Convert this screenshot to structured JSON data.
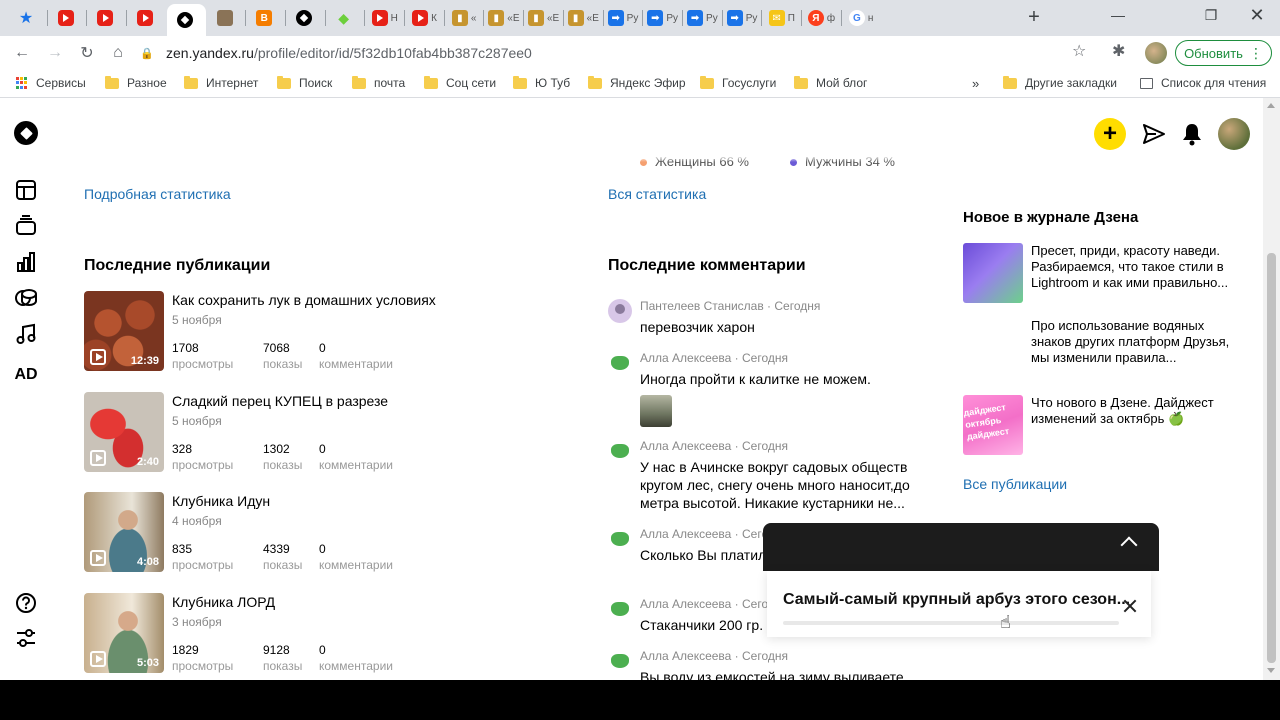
{
  "browser": {
    "tabs": [
      {
        "icon": "star",
        "label": ""
      },
      {
        "icon": "youtube",
        "label": ""
      },
      {
        "icon": "youtube",
        "label": ""
      },
      {
        "icon": "youtube",
        "label": ""
      },
      {
        "icon": "zen",
        "label": "",
        "active": true
      },
      {
        "icon": "image",
        "label": ""
      },
      {
        "icon": "blogger",
        "label": ""
      },
      {
        "icon": "zen",
        "label": ""
      },
      {
        "icon": "green-cube",
        "label": ""
      },
      {
        "icon": "youtube",
        "label": "Н"
      },
      {
        "icon": "youtube",
        "label": "К"
      },
      {
        "icon": "book",
        "label": "«"
      },
      {
        "icon": "book",
        "label": "«Е"
      },
      {
        "icon": "book",
        "label": "«Е"
      },
      {
        "icon": "book",
        "label": "«Е"
      },
      {
        "icon": "arrow",
        "label": "Ру"
      },
      {
        "icon": "arrow",
        "label": "Ру"
      },
      {
        "icon": "arrow",
        "label": "Ру"
      },
      {
        "icon": "arrow",
        "label": "Ру"
      },
      {
        "icon": "mail",
        "label": "П"
      },
      {
        "icon": "yandex",
        "label": "ф"
      },
      {
        "icon": "google",
        "label": "н"
      }
    ],
    "url_host": "zen.yandex.ru",
    "url_path": "/profile/editor/id/5f32db10fab4bb387c287ee0",
    "update_label": "Обновить",
    "bookmarks": [
      "Сервисы",
      "Разное",
      "Интернет",
      "Поиск",
      "почта",
      "Соц сети",
      "Ю Туб",
      "Яндекс Эфир",
      "Госуслуги",
      "Мой блог"
    ],
    "bookmarks_more": "»",
    "other_bookmarks": "Другие закладки",
    "reading_list": "Список для чтения"
  },
  "nav": {
    "ad_label": "AD"
  },
  "stats": {
    "women_partial": "Женщины 66 %",
    "men_partial": "Мужчины 34 %",
    "detailed_link": "Подробная статистика",
    "all_stats_link": "Вся статистика"
  },
  "publications": {
    "title": "Последние публикации",
    "items": [
      {
        "title": "Как сохранить лук в домашних условиях",
        "date": "5 ноября",
        "duration": "12:39",
        "views": "1708",
        "shows": "7068",
        "comments": "0"
      },
      {
        "title": "Сладкий перец КУПЕЦ в разрезе",
        "date": "5 ноября",
        "duration": "2:40",
        "views": "328",
        "shows": "1302",
        "comments": "0"
      },
      {
        "title": "Клубника Идун",
        "date": "4 ноября",
        "duration": "4:08",
        "views": "835",
        "shows": "4339",
        "comments": "0"
      },
      {
        "title": "Клубника ЛОРД",
        "date": "3 ноября",
        "duration": "5:03",
        "views": "1829",
        "shows": "9128",
        "comments": "0"
      }
    ],
    "labels": {
      "views": "просмотры",
      "shows": "показы",
      "comments": "комментарии"
    }
  },
  "comments": {
    "title": "Последние комментарии",
    "items": [
      {
        "meta": "Пантелеев Станислав · Сегодня",
        "text": "перевозчик харон",
        "avatar": "gray"
      },
      {
        "meta": "Алла Алексеева · Сегодня",
        "text": "Иногда пройти к калитке не можем.",
        "avatar": "green",
        "has_image": true
      },
      {
        "meta": "Алла Алексеева · Сегодня",
        "text": "У нас в Ачинске вокруг садовых обществ кругом лес, снегу очень много наносит,до метра высотой. Никакие кустарники не...",
        "avatar": "green"
      },
      {
        "meta": "Алла Алексеева · Сегодня",
        "text": "Сколько Вы платили за теплицу?",
        "avatar": "green"
      },
      {
        "meta": "Алла Алексеева · Сегодня",
        "text": "Стаканчики 200 гр.",
        "avatar": "green"
      },
      {
        "meta": "Алла Алексеева · Сегодня",
        "text": "Вы воду из емкостей на зиму выливаете",
        "avatar": "green"
      }
    ]
  },
  "journal": {
    "title": "Новое в журнале Дзена",
    "items": [
      {
        "title": "Пресет, приди, красоту наведи. Разбираемся, что такое стили в Lightroom и как ими правильно..."
      },
      {
        "title": "Про использование водяных знаков других платформ Друзья, мы изменили правила..."
      },
      {
        "title": "Что нового в Дзене. Дайджест изменений за октябрь 🍏",
        "thumb_text": "дайджест октябрь дайджест"
      }
    ],
    "all_link": "Все публикации"
  },
  "player": {
    "track_title": "Самый-самый крупный арбуз этого сезон...",
    "progress_fraction": 0.0
  },
  "colors": {
    "accent_yellow": "#ffdd00",
    "link_blue": "#1f6fb2",
    "update_green": "#1e8e3e"
  }
}
